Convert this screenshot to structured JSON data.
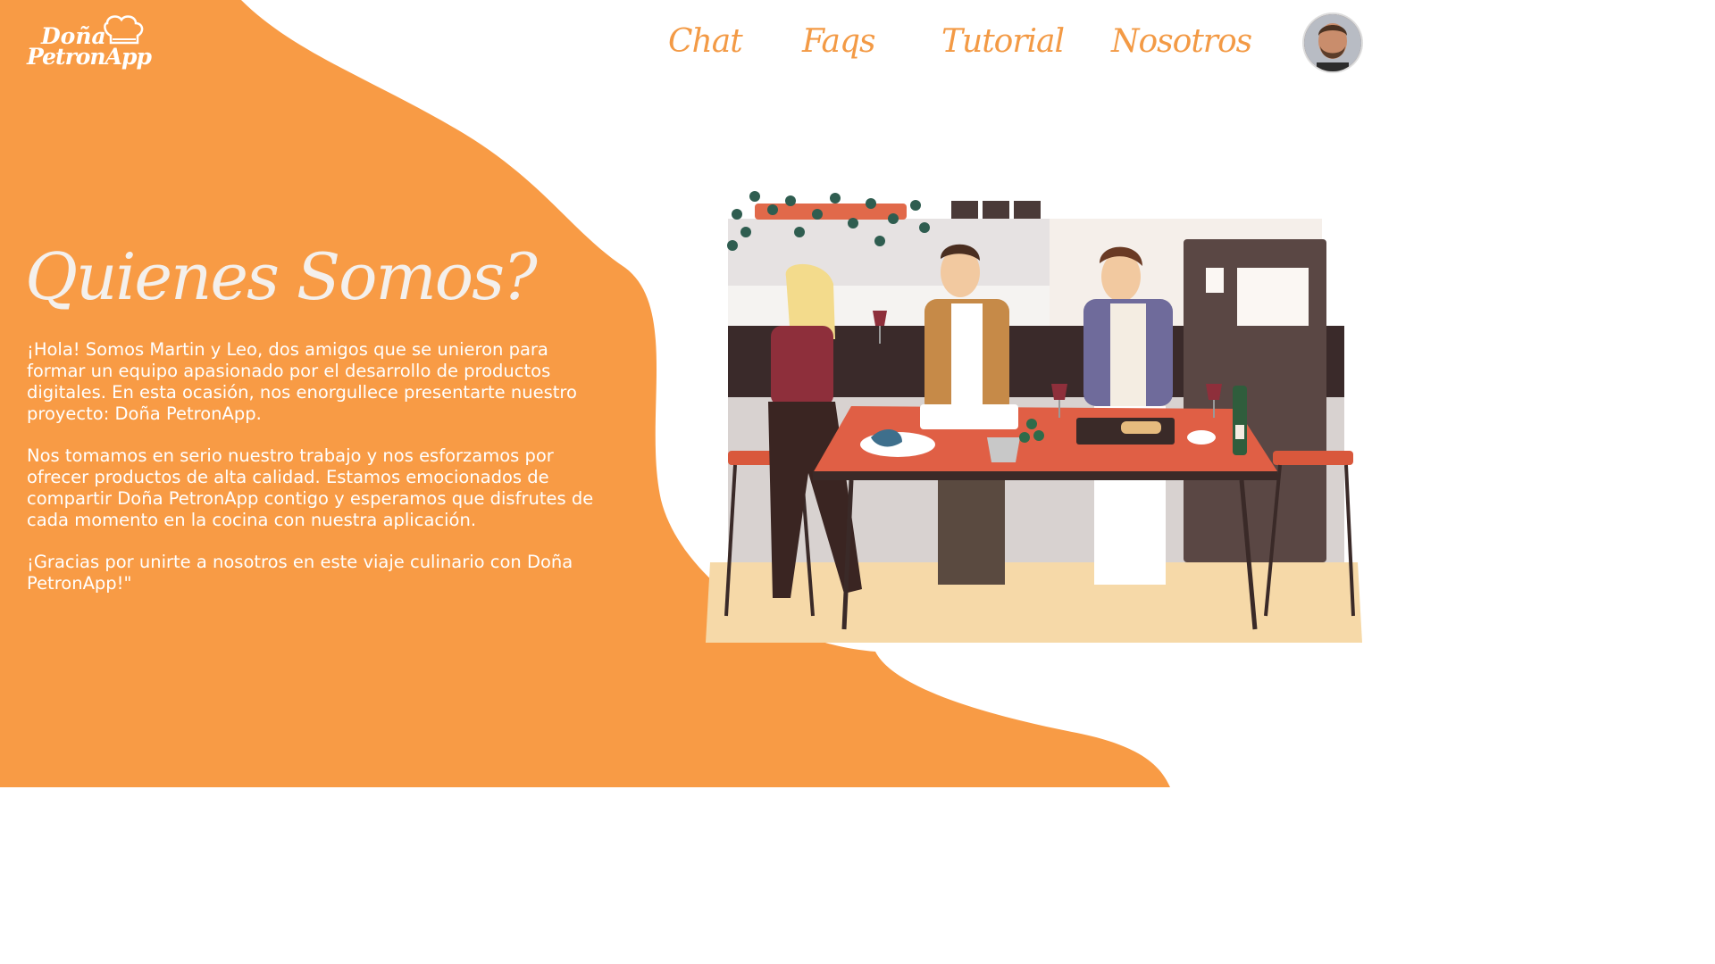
{
  "brand": {
    "line1": "Doña",
    "line2": "PetronApp"
  },
  "nav": {
    "items": [
      "Chat",
      "Faqs",
      "Tutorial",
      "Nosotros"
    ]
  },
  "user": {
    "avatar_icon": "user-avatar"
  },
  "page": {
    "title": "Quienes Somos?",
    "paragraphs": [
      "¡Hola! Somos Martin y Leo, dos amigos que se unieron para formar un equipo apasionado por el desarrollo de productos digitales. En esta ocasión, nos enorgullece presentarte nuestro proyecto: Doña PetronApp.",
      "Nos tomamos en serio nuestro trabajo y nos esforzamos por ofrecer productos de alta calidad. Estamos emocionados de compartir Doña PetronApp contigo y esperamos que disfrutes de cada momento en la cocina con nuestra aplicación.",
      "¡Gracias por unirte a nosotros en este viaje culinario con Doña PetronApp!\""
    ]
  },
  "colors": {
    "accent": "#F89B45",
    "background": "#FFFFFF",
    "title": "#F4F0EC",
    "nav": "#F39A45"
  }
}
